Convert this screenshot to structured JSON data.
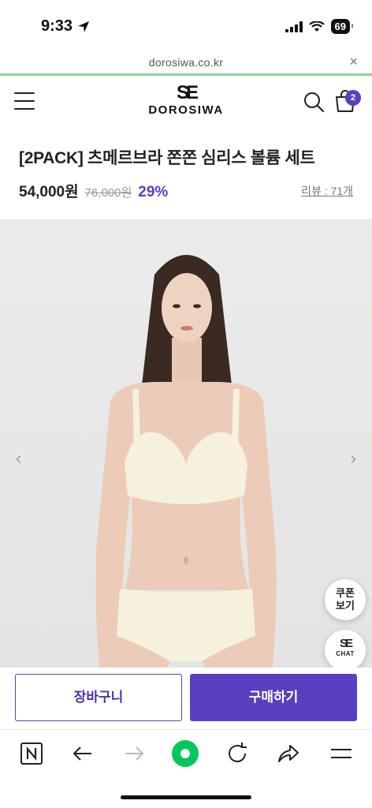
{
  "status": {
    "time": "9:33",
    "battery": "69"
  },
  "url_bar": {
    "domain": "dorosiwa.co.kr"
  },
  "header": {
    "logo_mark": "SE",
    "logo_text": "DOROSIWA",
    "cart_count": "2"
  },
  "product": {
    "title": "[2PACK] 츠메르브라 쫀쫀 심리스 볼륨 세트",
    "price": "54,000원",
    "original_price": "76,000원",
    "discount": "29%",
    "reviews": "리뷰 : 71개"
  },
  "floating": {
    "coupon_line1": "쿠폰",
    "coupon_line2": "보기",
    "chat_mark": "SE",
    "chat_label": "CHAT"
  },
  "actions": {
    "cart_label": "장바구니",
    "buy_label": "구매하기"
  },
  "colors": {
    "accent": "#5a3fc0",
    "url_underline": "#8fd19e"
  },
  "toolbar_icons": [
    "naver-n-icon",
    "back-arrow-icon",
    "forward-arrow-icon",
    "green-dot-icon",
    "refresh-icon",
    "share-icon",
    "menu-icon"
  ]
}
